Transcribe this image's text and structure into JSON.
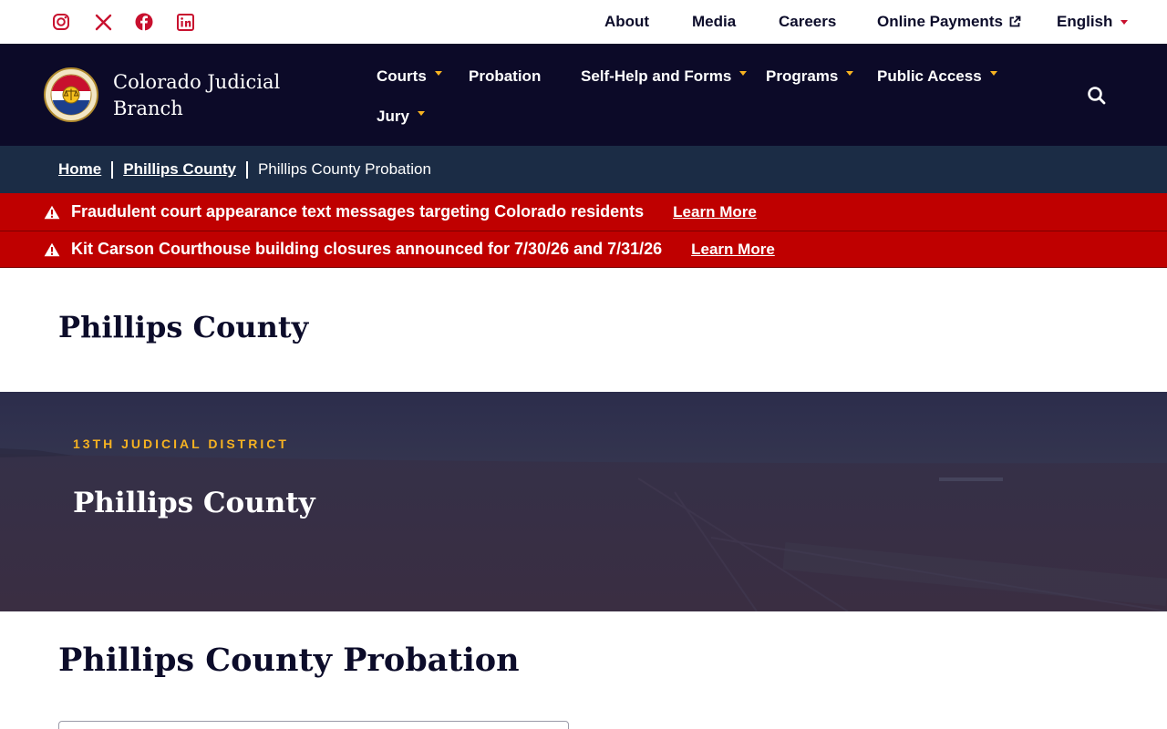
{
  "utility": {
    "social": [
      "instagram-icon",
      "x-icon",
      "facebook-icon",
      "linkedin-icon"
    ],
    "links": {
      "about": "About",
      "media": "Media",
      "careers": "Careers",
      "payments": "Online Payments"
    },
    "language": "English"
  },
  "brand": {
    "name_line1": "Colorado Judicial",
    "name_line2": "Branch"
  },
  "nav": {
    "courts": "Courts",
    "probation": "Probation",
    "self_help": "Self-Help and Forms",
    "programs": "Programs",
    "public_access": "Public Access",
    "jury": "Jury"
  },
  "breadcrumb": {
    "home": "Home",
    "county": "Phillips County",
    "current": "Phillips County Probation"
  },
  "alerts": [
    {
      "text": "Fraudulent court appearance text messages targeting Colorado residents",
      "link": "Learn More"
    },
    {
      "text": "Kit Carson Courthouse building closures announced for 7/30/26 and 7/31/26",
      "link": "Learn More"
    }
  ],
  "page": {
    "title": "Phillips County"
  },
  "hero": {
    "eyebrow": "13TH JUDICIAL DISTRICT",
    "title": "Phillips County"
  },
  "section": {
    "title": "Phillips County Probation"
  },
  "colors": {
    "navy": "#0c0a28",
    "breadcrumb_bg": "#1b2c45",
    "alert_red": "#bf0000",
    "gold": "#f6b221",
    "social_red": "#c8102e"
  }
}
